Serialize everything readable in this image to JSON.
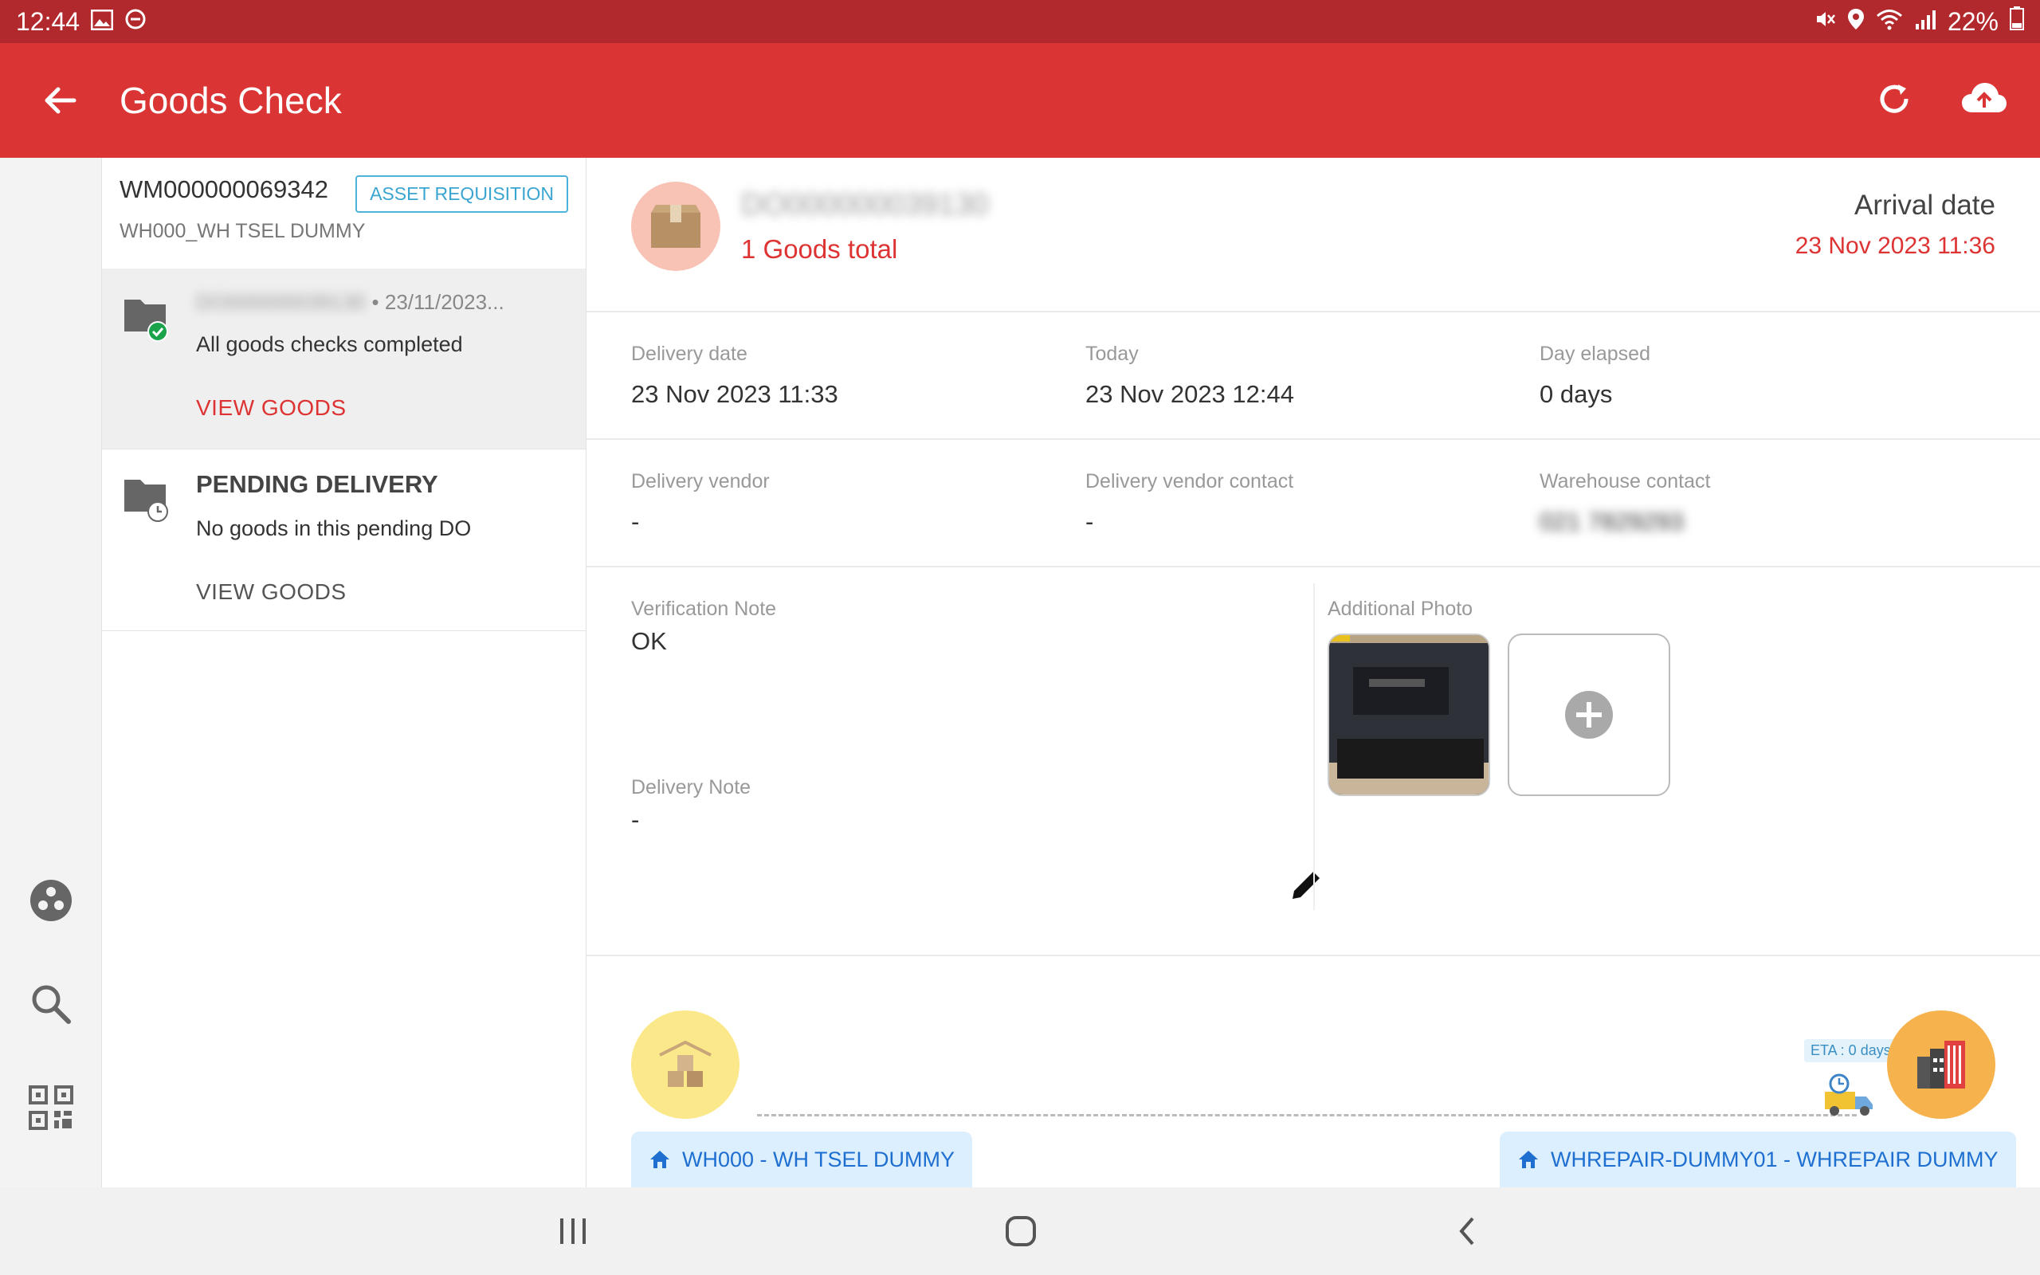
{
  "status_bar": {
    "time": "12:44",
    "battery": "22%"
  },
  "app_bar": {
    "title": "Goods Check"
  },
  "list_panel": {
    "header": {
      "code": "WM000000069342",
      "badge": "ASSET REQUISITION",
      "warehouse": "WH000_WH TSEL DUMMY"
    },
    "items": [
      {
        "id_blurred": "DO000000039130",
        "date": "• 23/11/2023...",
        "description": "All goods checks completed",
        "link": "VIEW GOODS"
      },
      {
        "heading": "PENDING DELIVERY",
        "description": "No goods in this pending DO",
        "link": "VIEW GOODS"
      }
    ]
  },
  "summary": {
    "do_number_blurred": "DO000000039130",
    "goods_total": "1 Goods total",
    "arrival_label": "Arrival date",
    "arrival_value": "23 Nov 2023 11:36"
  },
  "dates_row": [
    {
      "label": "Delivery date",
      "value": "23 Nov 2023 11:33"
    },
    {
      "label": "Today",
      "value": "23 Nov 2023 12:44"
    },
    {
      "label": "Day elapsed",
      "value": "0 days"
    }
  ],
  "contacts_row": [
    {
      "label": "Delivery vendor",
      "value": "-"
    },
    {
      "label": "Delivery vendor contact",
      "value": "-"
    },
    {
      "label": "Warehouse contact",
      "value": "021 7829293"
    }
  ],
  "notes": {
    "verification_label": "Verification Note",
    "verification_value": "OK",
    "delivery_label": "Delivery Note",
    "delivery_value": "-",
    "photo_label": "Additional Photo"
  },
  "route": {
    "eta": "ETA : 0 days",
    "origin": "WH000 - WH TSEL DUMMY",
    "destination": "WHREPAIR-DUMMY01 - WHREPAIR DUMMY"
  },
  "colors": {
    "appbar": "#db3434",
    "statusbar": "#b1292c",
    "accent_red": "#dd3333",
    "chip_bg": "#dcefff",
    "chip_text": "#1e6fd0"
  }
}
